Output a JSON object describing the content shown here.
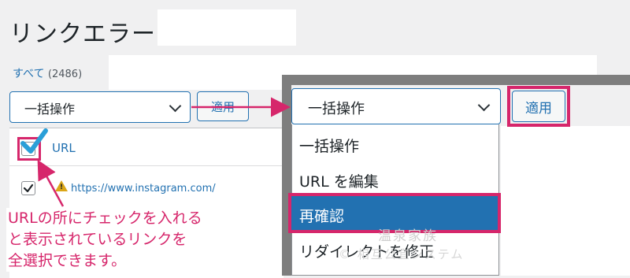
{
  "page": {
    "title": "リンクエラー"
  },
  "filter": {
    "all_label": "すべて",
    "all_count": "(2486)"
  },
  "bulk": {
    "select_label": "一括操作",
    "apply_label": "適用"
  },
  "table": {
    "header_label": "URL",
    "rows": [
      {
        "url": "https://www.instagram.com/"
      }
    ]
  },
  "annotation": {
    "note_lines": [
      "URLの所にチェックを入れる",
      "と表示されているリンクを",
      "全選択できます。"
    ],
    "color": "#d6266b"
  },
  "panel": {
    "select_label": "一括操作",
    "apply_label": "適用",
    "options": [
      "一括操作",
      "URL を編集",
      "再確認",
      "リダイレクトを修正"
    ],
    "selected_option": "再確認"
  },
  "watermark": {
    "line1": "温泉家族",
    "line2": "© 相互公宜システム"
  },
  "colors": {
    "accent": "#2271b1",
    "highlight": "#d6266b"
  }
}
